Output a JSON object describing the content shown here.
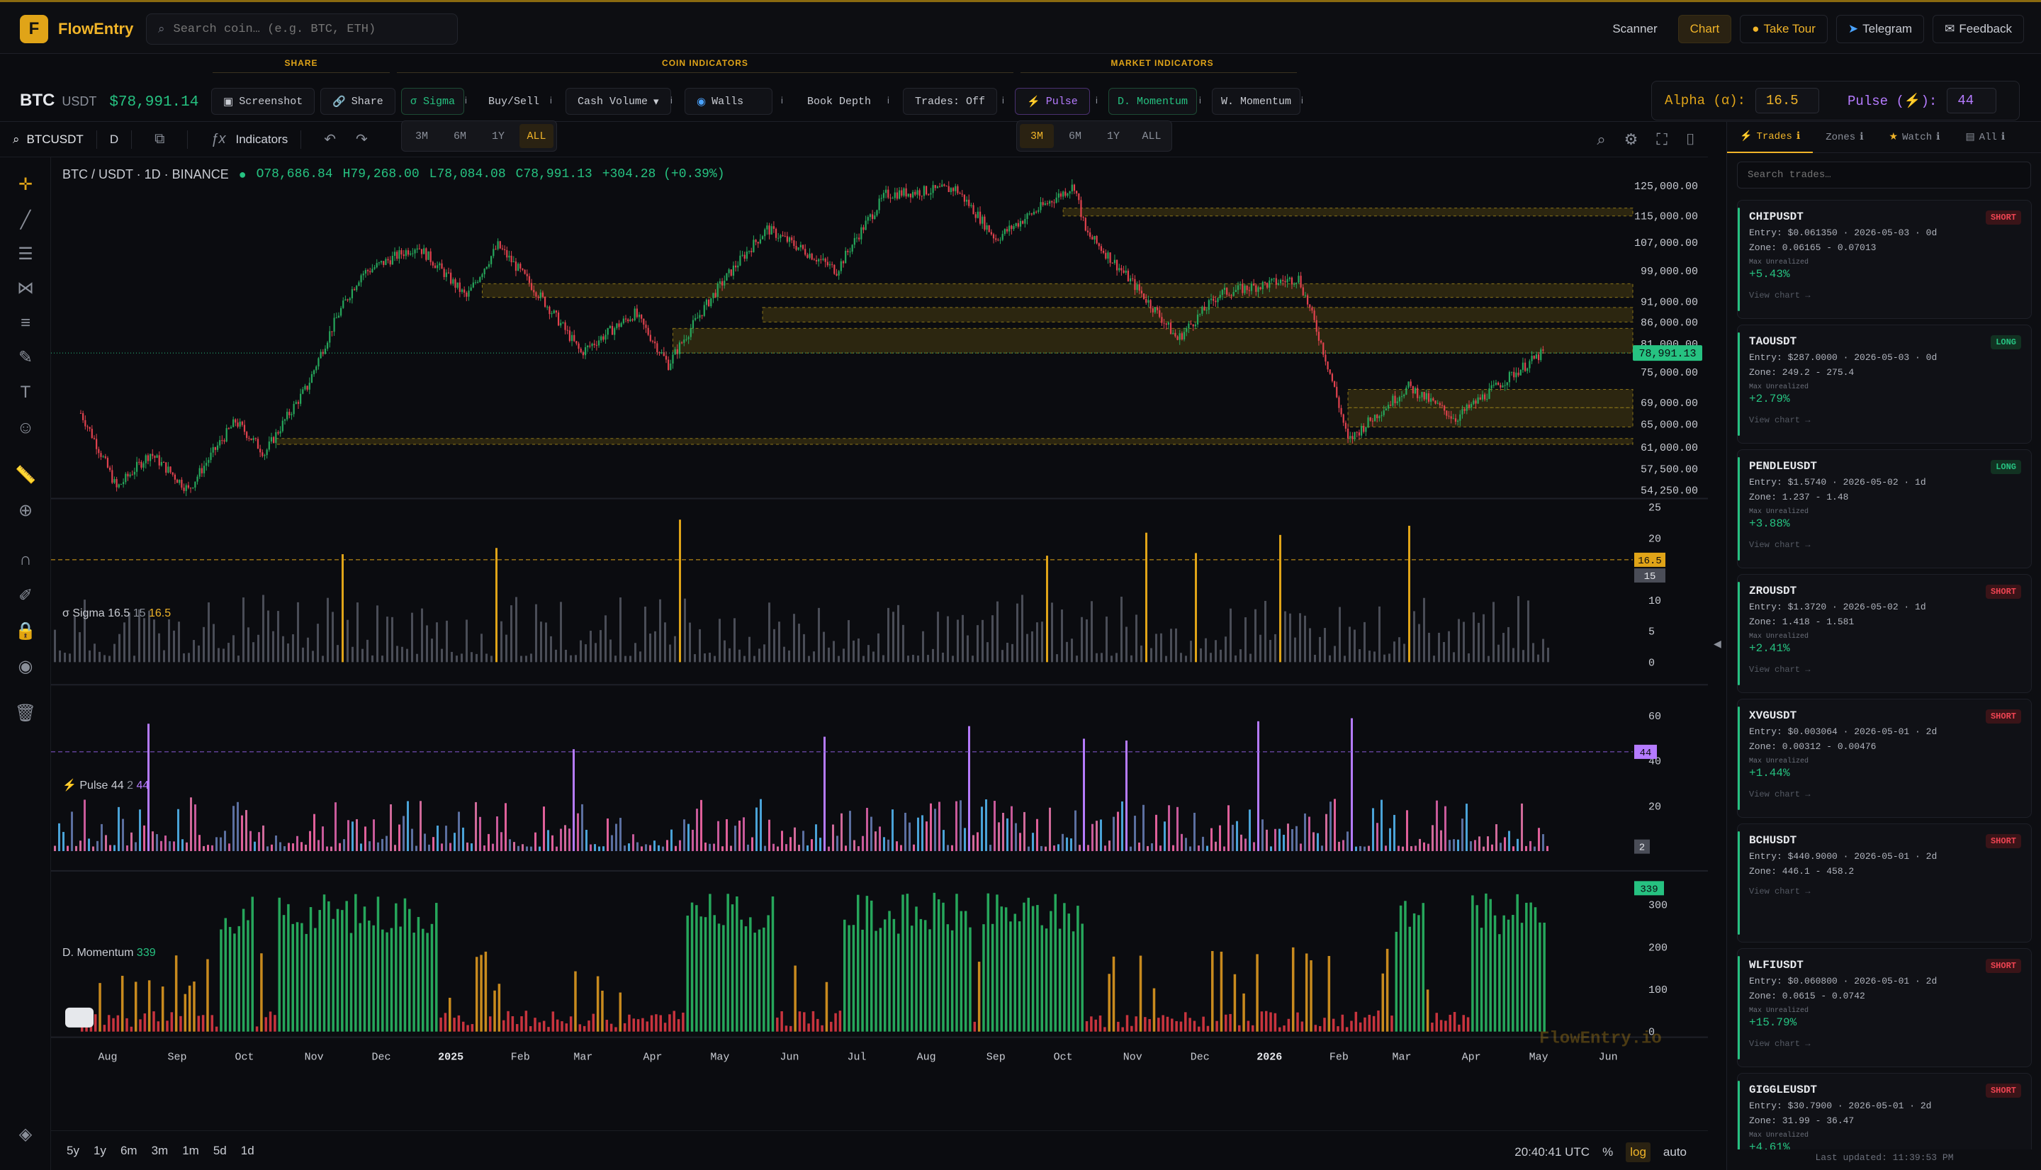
{
  "app": {
    "name": "FlowEntry",
    "logo_letter": "F",
    "accent": "#f0b429"
  },
  "search": {
    "placeholder": "Search coin… (e.g. BTC, ETH)"
  },
  "nav": {
    "scanner": "Scanner",
    "chart": "Chart",
    "tour": "Take Tour",
    "telegram": "Telegram",
    "feedback": "Feedback"
  },
  "ticker": {
    "symbol": "BTC",
    "pair": "USDT",
    "price": "$78,991.14"
  },
  "sections": {
    "share": "SHARE",
    "coin": "COIN INDICATORS",
    "market": "MARKET INDICATORS"
  },
  "toolbar": {
    "screenshot": "Screenshot",
    "share": "Share",
    "sigma": "σ Sigma",
    "buysell": "Buy/Sell",
    "cashvolume": "Cash Volume",
    "walls": "Walls",
    "bookdepth": "Book Depth",
    "trades": "Trades: Off",
    "pulse": "Pulse",
    "dmomentum": "D. Momentum",
    "wmomentum": "W. Momentum",
    "info": "i"
  },
  "ranges": [
    "3M",
    "6M",
    "1Y",
    "ALL"
  ],
  "alpha": {
    "label": "Alpha (α):",
    "value": "16.5",
    "pulse_label": "Pulse (⚡):",
    "pulse_value": "44"
  },
  "chart_header": {
    "symbol": "BTCUSDT",
    "interval": "D",
    "indicators": "Indicators"
  },
  "legend": {
    "title": "BTC / USDT · 1D · BINANCE",
    "o": "O78,686.84",
    "h": "H79,268.00",
    "l": "L78,084.08",
    "c": "C78,991.13",
    "chg": "+304.28 (+0.39%)"
  },
  "panes": {
    "sigma": {
      "name": "σ Sigma 16.5",
      "a": "15",
      "b": "16.5"
    },
    "pulse": {
      "name": "Pulse 44",
      "a": "2",
      "b": "44"
    },
    "momentum": {
      "name": "D. Momentum",
      "a": "339"
    }
  },
  "price_axis": [
    "125,000.00",
    "115,000.00",
    "107,000.00",
    "99,000.00",
    "91,000.00",
    "86,000.00",
    "81,000.00",
    "75,000.00",
    "69,000.00",
    "65,000.00",
    "61,000.00",
    "57,500.00",
    "54,250.00"
  ],
  "last_price_tag": "78,991.13",
  "sigma_axis": [
    "25",
    "20",
    "10",
    "5",
    "0"
  ],
  "sigma_tags": [
    "16.5",
    "15"
  ],
  "pulse_axis": [
    "60",
    "40",
    "20"
  ],
  "pulse_tags": [
    "44",
    "2"
  ],
  "momentum_axis": [
    "300",
    "200",
    "100",
    "0"
  ],
  "momentum_tag": "339",
  "time_axis": [
    "Aug",
    "Sep",
    "Oct",
    "Nov",
    "Dec",
    "2025",
    "Feb",
    "Mar",
    "Apr",
    "May",
    "Jun",
    "Jul",
    "Aug",
    "Sep",
    "Oct",
    "Nov",
    "Dec",
    "2026",
    "Feb",
    "Mar",
    "Apr",
    "May",
    "Jun"
  ],
  "watermark": "FlowEntry.io",
  "bottom": {
    "timeframes": [
      "5y",
      "1y",
      "6m",
      "3m",
      "1m",
      "5d",
      "1d"
    ],
    "clock": "20:40:41 UTC",
    "pct": "%",
    "log": "log",
    "auto": "auto"
  },
  "panel": {
    "tabs": [
      "Trades",
      "Zones",
      "Watch",
      "All"
    ],
    "search_placeholder": "Search trades…",
    "last_updated": "Last updated: 11:39:53 PM",
    "max_unrealized_label": "Max Unrealized",
    "view_chart": "View chart →",
    "trades": [
      {
        "symbol": "CHIPUSDT",
        "side": "SHORT",
        "entry": "Entry: $0.061350 · 2026-05-03 · 0d",
        "zone": "Zone: 0.06165 - 0.07013",
        "pnl": "+5.43%"
      },
      {
        "symbol": "TAOUSDT",
        "side": "LONG",
        "entry": "Entry: $287.0000 · 2026-05-03 · 0d",
        "zone": "Zone: 249.2 - 275.4",
        "pnl": "+2.79%"
      },
      {
        "symbol": "PENDLEUSDT",
        "side": "LONG",
        "entry": "Entry: $1.5740 · 2026-05-02 · 1d",
        "zone": "Zone: 1.237 - 1.48",
        "pnl": "+3.88%"
      },
      {
        "symbol": "ZROUSDT",
        "side": "SHORT",
        "entry": "Entry: $1.3720 · 2026-05-02 · 1d",
        "zone": "Zone: 1.418 - 1.581",
        "pnl": "+2.41%"
      },
      {
        "symbol": "XVGUSDT",
        "side": "SHORT",
        "entry": "Entry: $0.003064 · 2026-05-01 · 2d",
        "zone": "Zone: 0.00312 - 0.00476",
        "pnl": "+1.44%"
      },
      {
        "symbol": "BCHUSDT",
        "side": "SHORT",
        "entry": "Entry: $440.9000 · 2026-05-01 · 2d",
        "zone": "Zone: 446.1 - 458.2",
        "pnl": ""
      },
      {
        "symbol": "WLFIUSDT",
        "side": "SHORT",
        "entry": "Entry: $0.060800 · 2026-05-01 · 2d",
        "zone": "Zone: 0.0615 - 0.0742",
        "pnl": "+15.79%"
      },
      {
        "symbol": "GIGGLEUSDT",
        "side": "SHORT",
        "entry": "Entry: $30.7900 · 2026-05-01 · 2d",
        "zone": "Zone: 31.99 - 36.47",
        "pnl": "+4.61%"
      }
    ]
  },
  "chart_data": {
    "type": "candlestick",
    "title": "BTC / USDT · 1D · BINANCE",
    "x_start": "2024-07",
    "x_end": "2026-05",
    "ylim": [
      54250,
      125000
    ],
    "y_scale": "log",
    "close_path": [
      [
        "2024-07-20",
        67000
      ],
      [
        "2024-08-05",
        54500
      ],
      [
        "2024-08-20",
        60000
      ],
      [
        "2024-09-06",
        54250
      ],
      [
        "2024-09-27",
        65500
      ],
      [
        "2024-10-10",
        60000
      ],
      [
        "2024-10-29",
        72000
      ],
      [
        "2024-11-12",
        88000
      ],
      [
        "2024-11-22",
        98000
      ],
      [
        "2024-12-17",
        106000
      ],
      [
        "2025-01-08",
        92000
      ],
      [
        "2025-01-22",
        106000
      ],
      [
        "2025-02-28",
        79000
      ],
      [
        "2025-03-24",
        88000
      ],
      [
        "2025-04-08",
        76500
      ],
      [
        "2025-05-01",
        95000
      ],
      [
        "2025-05-22",
        111000
      ],
      [
        "2025-06-22",
        99000
      ],
      [
        "2025-07-14",
        122000
      ],
      [
        "2025-08-14",
        124000
      ],
      [
        "2025-09-01",
        108000
      ],
      [
        "2025-10-06",
        125000
      ],
      [
        "2025-10-11",
        110000
      ],
      [
        "2025-11-21",
        82000
      ],
      [
        "2025-12-10",
        93000
      ],
      [
        "2026-01-14",
        97000
      ],
      [
        "2026-02-05",
        62000
      ],
      [
        "2026-03-04",
        72000
      ],
      [
        "2026-03-25",
        66000
      ],
      [
        "2026-05-03",
        78991
      ]
    ],
    "zones": [
      [
        115000,
        117500
      ],
      [
        92000,
        95500
      ],
      [
        86000,
        89500
      ],
      [
        79000,
        84500
      ],
      [
        68000,
        71500
      ],
      [
        64500,
        68000
      ],
      [
        61500,
        62500
      ]
    ],
    "sigma_threshold": 16.5,
    "pulse_threshold": 44,
    "momentum_last": 339
  }
}
